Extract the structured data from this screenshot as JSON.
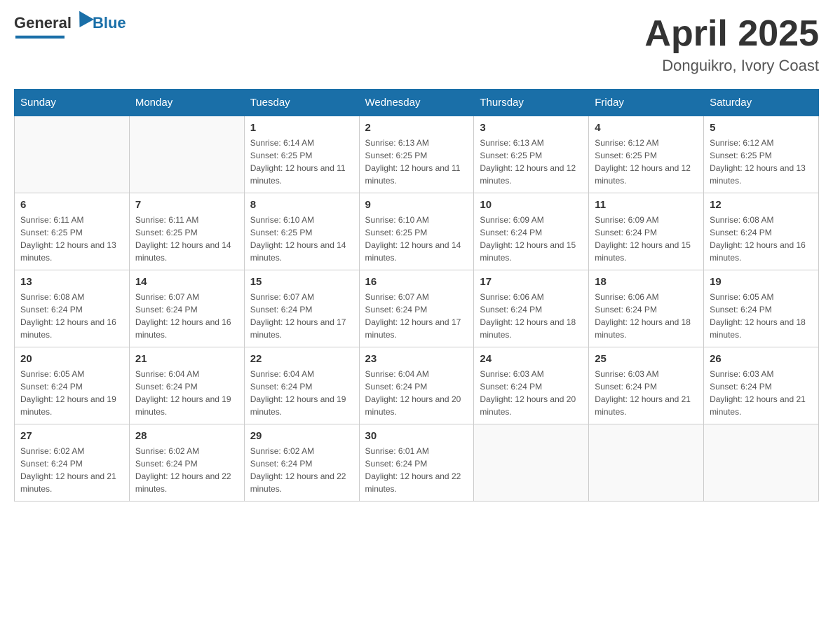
{
  "header": {
    "logo_general": "General",
    "logo_blue": "Blue",
    "title": "April 2025",
    "location": "Donguikro, Ivory Coast"
  },
  "days_of_week": [
    "Sunday",
    "Monday",
    "Tuesday",
    "Wednesday",
    "Thursday",
    "Friday",
    "Saturday"
  ],
  "weeks": [
    [
      {
        "day": "",
        "sunrise": "",
        "sunset": "",
        "daylight": ""
      },
      {
        "day": "",
        "sunrise": "",
        "sunset": "",
        "daylight": ""
      },
      {
        "day": "1",
        "sunrise": "Sunrise: 6:14 AM",
        "sunset": "Sunset: 6:25 PM",
        "daylight": "Daylight: 12 hours and 11 minutes."
      },
      {
        "day": "2",
        "sunrise": "Sunrise: 6:13 AM",
        "sunset": "Sunset: 6:25 PM",
        "daylight": "Daylight: 12 hours and 11 minutes."
      },
      {
        "day": "3",
        "sunrise": "Sunrise: 6:13 AM",
        "sunset": "Sunset: 6:25 PM",
        "daylight": "Daylight: 12 hours and 12 minutes."
      },
      {
        "day": "4",
        "sunrise": "Sunrise: 6:12 AM",
        "sunset": "Sunset: 6:25 PM",
        "daylight": "Daylight: 12 hours and 12 minutes."
      },
      {
        "day": "5",
        "sunrise": "Sunrise: 6:12 AM",
        "sunset": "Sunset: 6:25 PM",
        "daylight": "Daylight: 12 hours and 13 minutes."
      }
    ],
    [
      {
        "day": "6",
        "sunrise": "Sunrise: 6:11 AM",
        "sunset": "Sunset: 6:25 PM",
        "daylight": "Daylight: 12 hours and 13 minutes."
      },
      {
        "day": "7",
        "sunrise": "Sunrise: 6:11 AM",
        "sunset": "Sunset: 6:25 PM",
        "daylight": "Daylight: 12 hours and 14 minutes."
      },
      {
        "day": "8",
        "sunrise": "Sunrise: 6:10 AM",
        "sunset": "Sunset: 6:25 PM",
        "daylight": "Daylight: 12 hours and 14 minutes."
      },
      {
        "day": "9",
        "sunrise": "Sunrise: 6:10 AM",
        "sunset": "Sunset: 6:25 PM",
        "daylight": "Daylight: 12 hours and 14 minutes."
      },
      {
        "day": "10",
        "sunrise": "Sunrise: 6:09 AM",
        "sunset": "Sunset: 6:24 PM",
        "daylight": "Daylight: 12 hours and 15 minutes."
      },
      {
        "day": "11",
        "sunrise": "Sunrise: 6:09 AM",
        "sunset": "Sunset: 6:24 PM",
        "daylight": "Daylight: 12 hours and 15 minutes."
      },
      {
        "day": "12",
        "sunrise": "Sunrise: 6:08 AM",
        "sunset": "Sunset: 6:24 PM",
        "daylight": "Daylight: 12 hours and 16 minutes."
      }
    ],
    [
      {
        "day": "13",
        "sunrise": "Sunrise: 6:08 AM",
        "sunset": "Sunset: 6:24 PM",
        "daylight": "Daylight: 12 hours and 16 minutes."
      },
      {
        "day": "14",
        "sunrise": "Sunrise: 6:07 AM",
        "sunset": "Sunset: 6:24 PM",
        "daylight": "Daylight: 12 hours and 16 minutes."
      },
      {
        "day": "15",
        "sunrise": "Sunrise: 6:07 AM",
        "sunset": "Sunset: 6:24 PM",
        "daylight": "Daylight: 12 hours and 17 minutes."
      },
      {
        "day": "16",
        "sunrise": "Sunrise: 6:07 AM",
        "sunset": "Sunset: 6:24 PM",
        "daylight": "Daylight: 12 hours and 17 minutes."
      },
      {
        "day": "17",
        "sunrise": "Sunrise: 6:06 AM",
        "sunset": "Sunset: 6:24 PM",
        "daylight": "Daylight: 12 hours and 18 minutes."
      },
      {
        "day": "18",
        "sunrise": "Sunrise: 6:06 AM",
        "sunset": "Sunset: 6:24 PM",
        "daylight": "Daylight: 12 hours and 18 minutes."
      },
      {
        "day": "19",
        "sunrise": "Sunrise: 6:05 AM",
        "sunset": "Sunset: 6:24 PM",
        "daylight": "Daylight: 12 hours and 18 minutes."
      }
    ],
    [
      {
        "day": "20",
        "sunrise": "Sunrise: 6:05 AM",
        "sunset": "Sunset: 6:24 PM",
        "daylight": "Daylight: 12 hours and 19 minutes."
      },
      {
        "day": "21",
        "sunrise": "Sunrise: 6:04 AM",
        "sunset": "Sunset: 6:24 PM",
        "daylight": "Daylight: 12 hours and 19 minutes."
      },
      {
        "day": "22",
        "sunrise": "Sunrise: 6:04 AM",
        "sunset": "Sunset: 6:24 PM",
        "daylight": "Daylight: 12 hours and 19 minutes."
      },
      {
        "day": "23",
        "sunrise": "Sunrise: 6:04 AM",
        "sunset": "Sunset: 6:24 PM",
        "daylight": "Daylight: 12 hours and 20 minutes."
      },
      {
        "day": "24",
        "sunrise": "Sunrise: 6:03 AM",
        "sunset": "Sunset: 6:24 PM",
        "daylight": "Daylight: 12 hours and 20 minutes."
      },
      {
        "day": "25",
        "sunrise": "Sunrise: 6:03 AM",
        "sunset": "Sunset: 6:24 PM",
        "daylight": "Daylight: 12 hours and 21 minutes."
      },
      {
        "day": "26",
        "sunrise": "Sunrise: 6:03 AM",
        "sunset": "Sunset: 6:24 PM",
        "daylight": "Daylight: 12 hours and 21 minutes."
      }
    ],
    [
      {
        "day": "27",
        "sunrise": "Sunrise: 6:02 AM",
        "sunset": "Sunset: 6:24 PM",
        "daylight": "Daylight: 12 hours and 21 minutes."
      },
      {
        "day": "28",
        "sunrise": "Sunrise: 6:02 AM",
        "sunset": "Sunset: 6:24 PM",
        "daylight": "Daylight: 12 hours and 22 minutes."
      },
      {
        "day": "29",
        "sunrise": "Sunrise: 6:02 AM",
        "sunset": "Sunset: 6:24 PM",
        "daylight": "Daylight: 12 hours and 22 minutes."
      },
      {
        "day": "30",
        "sunrise": "Sunrise: 6:01 AM",
        "sunset": "Sunset: 6:24 PM",
        "daylight": "Daylight: 12 hours and 22 minutes."
      },
      {
        "day": "",
        "sunrise": "",
        "sunset": "",
        "daylight": ""
      },
      {
        "day": "",
        "sunrise": "",
        "sunset": "",
        "daylight": ""
      },
      {
        "day": "",
        "sunrise": "",
        "sunset": "",
        "daylight": ""
      }
    ]
  ]
}
